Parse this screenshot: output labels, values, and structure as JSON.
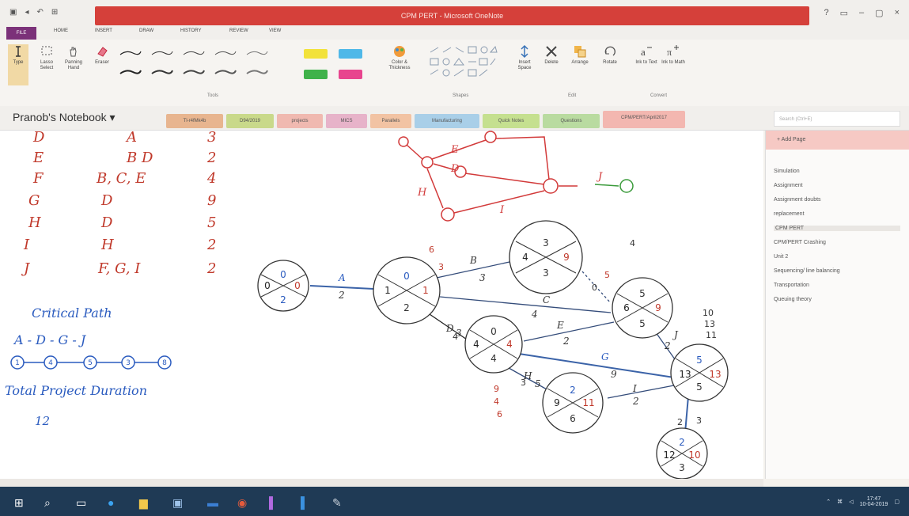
{
  "window": {
    "title": "CPM PERT - Microsoft OneNote",
    "controls": [
      "?",
      "▭",
      "–",
      "▢",
      "×"
    ]
  },
  "ribbon_tabs": [
    "FILE",
    "HOME",
    "INSERT",
    "DRAW",
    "HISTORY",
    "REVIEW",
    "VIEW"
  ],
  "ribbon": {
    "tools_labels": [
      "Type",
      "Lasso Select",
      "Panning Hand",
      "Eraser"
    ],
    "color_label": "Color & Thickness",
    "edit_labels": [
      "Insert Space",
      "Delete",
      "Arrange",
      "Rotate"
    ],
    "convert_labels": [
      "Ink to Text",
      "Ink to Math"
    ],
    "groups": [
      "Tools",
      "Shapes",
      "Edit",
      "Convert"
    ]
  },
  "notebook": {
    "name": "Pranob's Notebook ▾",
    "sections": [
      {
        "label": "Tl-r4fMk4b",
        "color": "#e8b58f"
      },
      {
        "label": "D94/2019",
        "color": "#c9d98a"
      },
      {
        "label": "projects",
        "color": "#f0b9b0"
      },
      {
        "label": "MICS",
        "color": "#e7b3c9"
      },
      {
        "label": "Parallels",
        "color": "#f2c3a3"
      },
      {
        "label": "Manufacturing",
        "color": "#a9cfe8"
      },
      {
        "label": "Quick Notes",
        "color": "#c5e08f"
      },
      {
        "label": "Questions",
        "color": "#b9dba0"
      },
      {
        "label": "CPM/PERT/April2017",
        "color": "#f3b7b0"
      }
    ],
    "search_placeholder": "Search (Ctrl+E)"
  },
  "pages_panel": {
    "add_page": "+ Add Page",
    "pages": [
      "Simulation",
      "Assignment",
      "Assignment doubts",
      "replacement",
      "CPM PERT",
      "CPM/PERT Crashing",
      "Unit 2",
      "Sequencing/ line balancing",
      "Transportation",
      "Queuing theory"
    ],
    "selected_index": 4
  },
  "canvas": {
    "table_rows": [
      {
        "activity": "D",
        "predecessor": "A",
        "duration": "3"
      },
      {
        "activity": "E",
        "predecessor": "B D",
        "duration": "2"
      },
      {
        "activity": "F",
        "predecessor": "B, C, E",
        "duration": "4"
      },
      {
        "activity": "G",
        "predecessor": "D",
        "duration": "9"
      },
      {
        "activity": "H",
        "predecessor": "D",
        "duration": "5"
      },
      {
        "activity": "I",
        "predecessor": "H",
        "duration": "2"
      },
      {
        "activity": "J",
        "predecessor": "F, G, I",
        "duration": "2"
      }
    ],
    "critical_path_title": "Critical Path",
    "critical_path": "A - D - G - J",
    "critical_nodes": [
      "1",
      "4",
      "5",
      "3",
      "8"
    ],
    "duration_title": "Total Project Duration",
    "duration_value": "12",
    "network_nodes": [
      {
        "id": "0",
        "es": "0",
        "ef": "0",
        "ls": "2",
        "lf": ""
      },
      {
        "id": "1",
        "es": "0",
        "ef": "1",
        "ls": "2",
        "lf": ""
      },
      {
        "id": "4",
        "es": "3",
        "ef": "9",
        "ls": "3",
        "lf": ""
      },
      {
        "id": "6",
        "es": "5",
        "ef": "9",
        "ls": "5",
        "lf": ""
      },
      {
        "id": "4",
        "es": "0",
        "ef": "4",
        "ls": "4",
        "lf": ""
      },
      {
        "id": "13",
        "es": "5",
        "ef": "13",
        "ls": "5",
        "lf": ""
      },
      {
        "id": "9",
        "es": "2",
        "ef": "11",
        "ls": "6",
        "lf": ""
      },
      {
        "id": "12",
        "es": "2",
        "ef": "10",
        "ls": "3",
        "lf": ""
      }
    ],
    "edge_labels": [
      "A",
      "2",
      "B",
      "3",
      "C",
      "4",
      "D",
      "3",
      "E",
      "2",
      "G",
      "9",
      "H",
      "5",
      "I",
      "2",
      "J",
      "2"
    ],
    "red_graph_labels": [
      "E",
      "D",
      "H",
      "I",
      "J",
      "A"
    ],
    "side_numbers": [
      "6",
      "3",
      "0",
      "5",
      "4",
      "10",
      "13",
      "11",
      "9",
      "4",
      "6",
      "4",
      "3",
      "3",
      "2"
    ]
  },
  "taskbar": {
    "time": "17:47",
    "date": "10-04-2019"
  }
}
